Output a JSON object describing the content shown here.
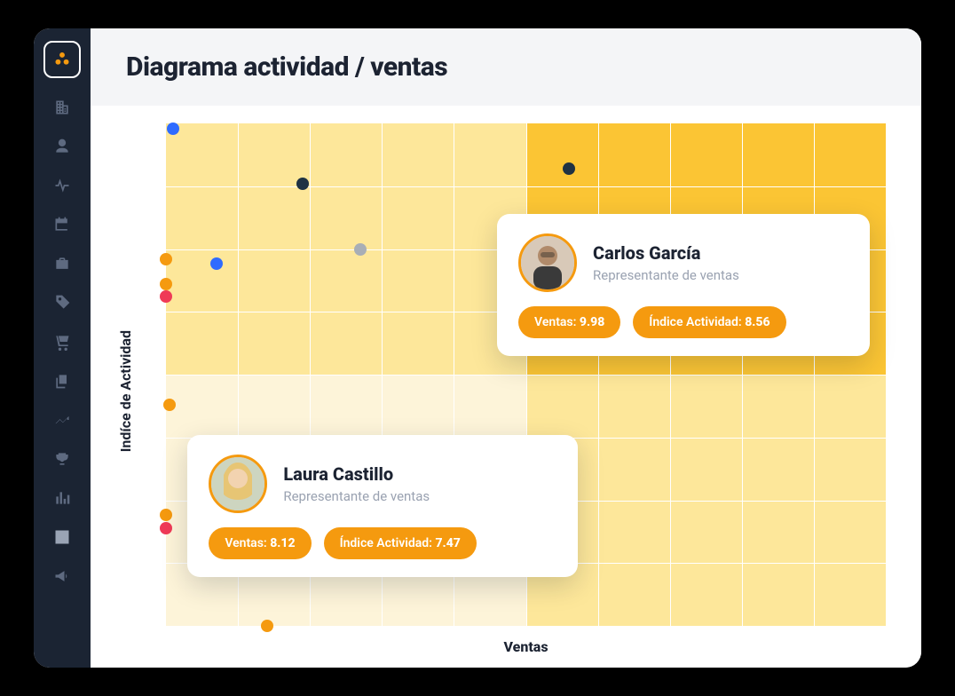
{
  "header": {
    "title": "Diagrama actividad / ventas"
  },
  "axes": {
    "xlabel": "Ventas",
    "ylabel": "Indíce de Actividad"
  },
  "sidebar_icons": [
    "building-icon",
    "user-icon",
    "pulse-icon",
    "calendar-icon",
    "briefcase-icon",
    "tag-icon",
    "cart-icon",
    "copy-icon",
    "trend-icon",
    "trophy-icon",
    "bar-chart-icon",
    "analytics-icon",
    "megaphone-icon"
  ],
  "tooltips": {
    "carlos": {
      "name": "Carlos García",
      "role": "Representante de ventas",
      "ventas_label": "Ventas:",
      "ventas_value": "9.98",
      "indice_label": "Índice Actividad:",
      "indice_value": "8.56"
    },
    "laura": {
      "name": "Laura Castillo",
      "role": "Representante de ventas",
      "ventas_label": "Ventas:",
      "ventas_value": "8.12",
      "indice_label": "Índice Actividad:",
      "indice_value": "7.47"
    }
  },
  "chart_data": {
    "type": "scatter",
    "xlabel": "Ventas",
    "ylabel": "Indíce de Actividad",
    "xlim": [
      0,
      10
    ],
    "ylim": [
      0,
      10
    ],
    "title": "Diagrama actividad / ventas",
    "series": [
      {
        "name": "blue",
        "color": "#2f6bff",
        "points": [
          [
            0.1,
            9.9
          ],
          [
            0.7,
            7.2
          ]
        ]
      },
      {
        "name": "navy",
        "color": "#1f3243",
        "points": [
          [
            1.9,
            8.8
          ],
          [
            5.6,
            9.1
          ]
        ]
      },
      {
        "name": "gray",
        "color": "#a8aeb6",
        "points": [
          [
            2.7,
            7.5
          ]
        ]
      },
      {
        "name": "orange",
        "color": "#f59a0f",
        "points": [
          [
            0.0,
            7.3
          ],
          [
            0.0,
            6.8
          ],
          [
            0.05,
            4.4
          ],
          [
            0.0,
            2.2
          ],
          [
            1.4,
            0.0
          ]
        ]
      },
      {
        "name": "red",
        "color": "#ef3a57",
        "points": [
          [
            0.0,
            6.55
          ],
          [
            0.0,
            1.95
          ]
        ]
      }
    ],
    "highlighted": [
      {
        "name": "Carlos García",
        "role": "Representante de ventas",
        "ventas": 9.98,
        "indice_actividad": 8.56
      },
      {
        "name": "Laura Castillo",
        "role": "Representante de ventas",
        "ventas": 8.12,
        "indice_actividad": 7.47
      }
    ]
  }
}
